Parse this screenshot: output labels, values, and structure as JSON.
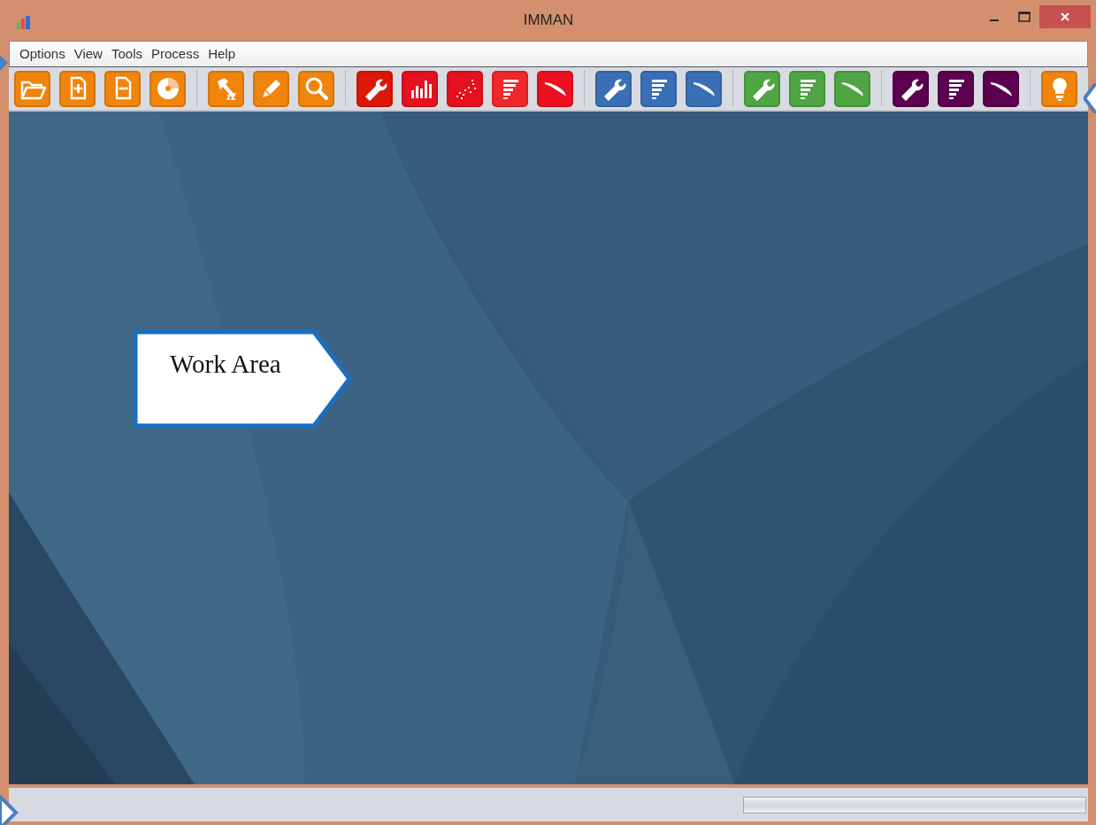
{
  "window": {
    "title": "IMMAN"
  },
  "menu": [
    "Options",
    "View",
    "Tools",
    "Process",
    "Help"
  ],
  "toolbar": [
    [
      {
        "kind": "folder",
        "color": "#f0840c"
      },
      {
        "kind": "file-plus",
        "color": "#f0840c"
      },
      {
        "kind": "file-minus",
        "color": "#f0840c"
      },
      {
        "kind": "disc",
        "color": "#f0840c"
      }
    ],
    [
      {
        "kind": "hammer",
        "color": "#f0840c"
      },
      {
        "kind": "pencil",
        "color": "#f0840c"
      },
      {
        "kind": "search",
        "color": "#f0840c"
      }
    ],
    [
      {
        "kind": "wrench",
        "color": "#dc1808"
      },
      {
        "kind": "bars",
        "color": "#e6101e"
      },
      {
        "kind": "scatter",
        "color": "#e6101e"
      },
      {
        "kind": "list",
        "color": "#f02828"
      },
      {
        "kind": "curve",
        "color": "#ee1020"
      }
    ],
    [
      {
        "kind": "wrench",
        "color": "#3a6fb5"
      },
      {
        "kind": "list",
        "color": "#3a6fb5"
      },
      {
        "kind": "curve",
        "color": "#3a6fb5"
      }
    ],
    [
      {
        "kind": "wrench",
        "color": "#4fa444"
      },
      {
        "kind": "list",
        "color": "#4fa444"
      },
      {
        "kind": "curve",
        "color": "#4fa444"
      }
    ],
    [
      {
        "kind": "wrench",
        "color": "#5c0050"
      },
      {
        "kind": "list",
        "color": "#5c0050"
      },
      {
        "kind": "curve",
        "color": "#5c0050"
      }
    ],
    [
      {
        "kind": "bulb",
        "color": "#f0840c"
      }
    ]
  ],
  "callout": {
    "text": "Work Area"
  },
  "status_bar": {
    "progress": {
      "level": 0
    }
  }
}
